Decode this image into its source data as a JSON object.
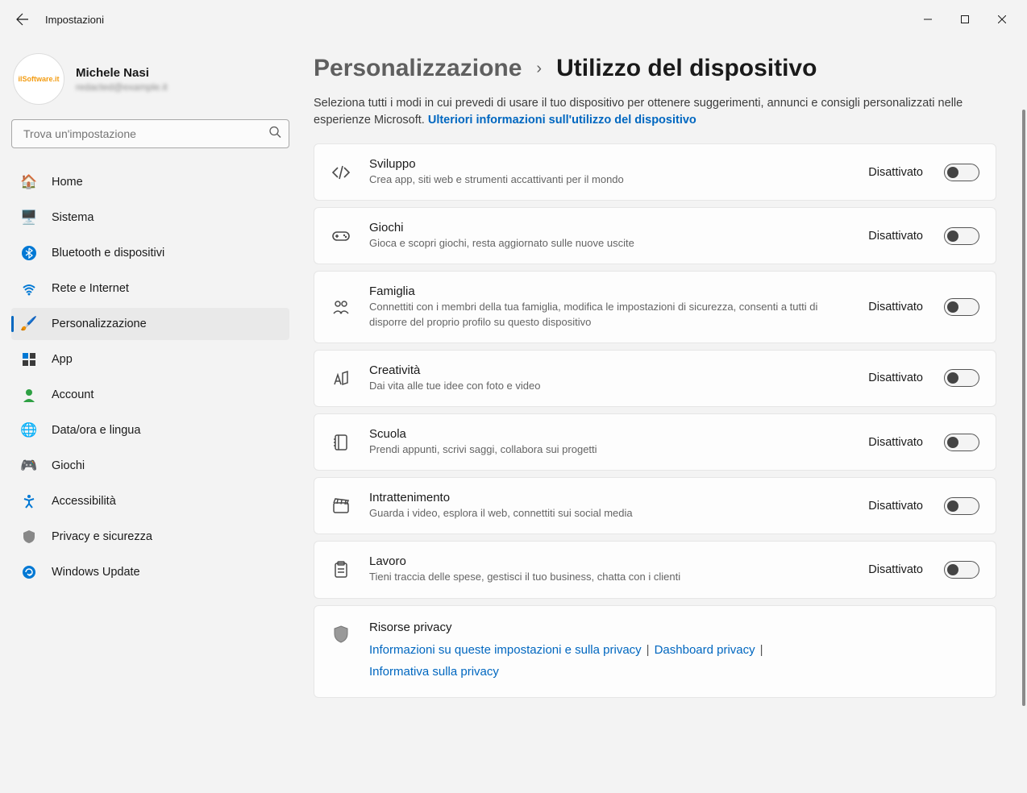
{
  "window": {
    "title": "Impostazioni"
  },
  "profile": {
    "name": "Michele Nasi",
    "email": "redacted@example.it",
    "avatar_text": "ilSoftware.it"
  },
  "search": {
    "placeholder": "Trova un'impostazione"
  },
  "nav": {
    "items": [
      {
        "label": "Home"
      },
      {
        "label": "Sistema"
      },
      {
        "label": "Bluetooth e dispositivi"
      },
      {
        "label": "Rete e Internet"
      },
      {
        "label": "Personalizzazione"
      },
      {
        "label": "App"
      },
      {
        "label": "Account"
      },
      {
        "label": "Data/ora e lingua"
      },
      {
        "label": "Giochi"
      },
      {
        "label": "Accessibilità"
      },
      {
        "label": "Privacy e sicurezza"
      },
      {
        "label": "Windows Update"
      }
    ]
  },
  "breadcrumb": {
    "parent": "Personalizzazione",
    "current": "Utilizzo del dispositivo"
  },
  "intro": {
    "text": "Seleziona tutti i modi in cui prevedi di usare il tuo dispositivo per ottenere suggerimenti, annunci e consigli personalizzati nelle esperienze Microsoft. ",
    "link": "Ulteriori informazioni sull'utilizzo del dispositivo"
  },
  "cards": [
    {
      "title": "Sviluppo",
      "desc": "Crea app, siti web e strumenti accattivanti per il mondo",
      "status": "Disattivato"
    },
    {
      "title": "Giochi",
      "desc": "Gioca e scopri giochi, resta aggiornato sulle nuove uscite",
      "status": "Disattivato"
    },
    {
      "title": "Famiglia",
      "desc": "Connettiti con i membri della tua famiglia, modifica le impostazioni di sicurezza, consenti a tutti di disporre del proprio profilo su questo dispositivo",
      "status": "Disattivato"
    },
    {
      "title": "Creatività",
      "desc": "Dai vita alle tue idee con foto e video",
      "status": "Disattivato"
    },
    {
      "title": "Scuola",
      "desc": "Prendi appunti, scrivi saggi, collabora sui progetti",
      "status": "Disattivato"
    },
    {
      "title": "Intrattenimento",
      "desc": "Guarda i video, esplora il web, connettiti sui social media",
      "status": "Disattivato"
    },
    {
      "title": "Lavoro",
      "desc": "Tieni traccia delle spese, gestisci il tuo business, chatta con i clienti",
      "status": "Disattivato"
    }
  ],
  "privacy": {
    "title": "Risorse privacy",
    "link1": "Informazioni su queste impostazioni e sulla privacy",
    "link2": "Dashboard privacy",
    "link3": "Informativa sulla privacy"
  }
}
